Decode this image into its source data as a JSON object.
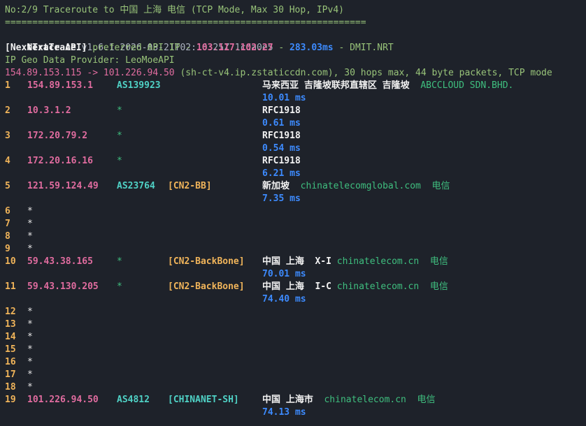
{
  "header": {
    "title": "No:2/9 Traceroute to 中国 上海 电信 (TCP Mode, Max 30 Hop, IPv4)",
    "rule": "==================================================================",
    "app_name": "NextTrace",
    "version_info": "v1.6.1 2026-03-21T02:16:25Z 1cda0e5",
    "api_tag": "[NextTrace API]",
    "api_pref": "preferred API IP - ",
    "api_ip": "103.117.102.27",
    "api_sep1": " - ",
    "api_latency": "283.03ms",
    "api_sep2": " - ",
    "api_node": "DMIT.NRT",
    "geo_provider": "IP Geo Data Provider: LeoMoeAPI",
    "route_src": "154.89.153.115 -> 101.226.94.50",
    "route_rest": " (sh-ct-v4.ip.zstaticcdn.com), 30 hops max, 44 byte packets, TCP mode"
  },
  "hops": [
    {
      "n": "1",
      "ip": "154.89.153.1",
      "asn": "AS139923",
      "tag": "",
      "geo": "马来西亚 吉隆坡联邦直辖区 吉隆坡",
      "org": "ABCCLOUD SDN.BHD.",
      "isp": "",
      "rtt": "10.01 ms"
    },
    {
      "n": "2",
      "ip": "10.3.1.2",
      "asn": "*",
      "tag": "",
      "geo": "RFC1918",
      "org": "",
      "isp": "",
      "rtt": "0.61 ms"
    },
    {
      "n": "3",
      "ip": "172.20.79.2",
      "asn": "*",
      "tag": "",
      "geo": "RFC1918",
      "org": "",
      "isp": "",
      "rtt": "0.54 ms"
    },
    {
      "n": "4",
      "ip": "172.20.16.16",
      "asn": "*",
      "tag": "",
      "geo": "RFC1918",
      "org": "",
      "isp": "",
      "rtt": "6.21 ms"
    },
    {
      "n": "5",
      "ip": "121.59.124.49",
      "asn": "AS23764",
      "tag": "[CN2-BB]",
      "geo": "新加坡",
      "org": "chinatelecomglobal.com",
      "isp": "电信",
      "rtt": "7.35 ms"
    },
    {
      "n": "6",
      "star": "*"
    },
    {
      "n": "7",
      "star": "*"
    },
    {
      "n": "8",
      "star": "*"
    },
    {
      "n": "9",
      "star": "*"
    },
    {
      "n": "10",
      "ip": "59.43.38.165",
      "asn": "*",
      "tag": "[CN2-BackBone]",
      "geo": "中国 上海",
      "geo_code": "X-I",
      "org": "chinatelecom.cn",
      "isp": "电信",
      "rtt": "70.01 ms"
    },
    {
      "n": "11",
      "ip": "59.43.130.205",
      "asn": "*",
      "tag": "[CN2-BackBone]",
      "geo": "中国 上海",
      "geo_code": "I-C",
      "org": "chinatelecom.cn",
      "isp": "电信",
      "rtt": "74.40 ms"
    },
    {
      "n": "12",
      "star": "*"
    },
    {
      "n": "13",
      "star": "*"
    },
    {
      "n": "14",
      "star": "*"
    },
    {
      "n": "15",
      "star": "*"
    },
    {
      "n": "16",
      "star": "*"
    },
    {
      "n": "17",
      "star": "*"
    },
    {
      "n": "18",
      "star": "*"
    },
    {
      "n": "19",
      "ip": "101.226.94.50",
      "asn": "AS4812",
      "tag": "[CHINANET-SH]",
      "geo": "中国 上海市",
      "org": "chinatelecom.cn",
      "isp": "电信",
      "rtt": "74.13 ms"
    }
  ],
  "colors": {
    "background": "#1e222a",
    "green": "#98c379",
    "pink": "#e06c9f",
    "blue": "#3d8bff",
    "orange": "#f0b45a",
    "teal": "#4fd1c5"
  }
}
